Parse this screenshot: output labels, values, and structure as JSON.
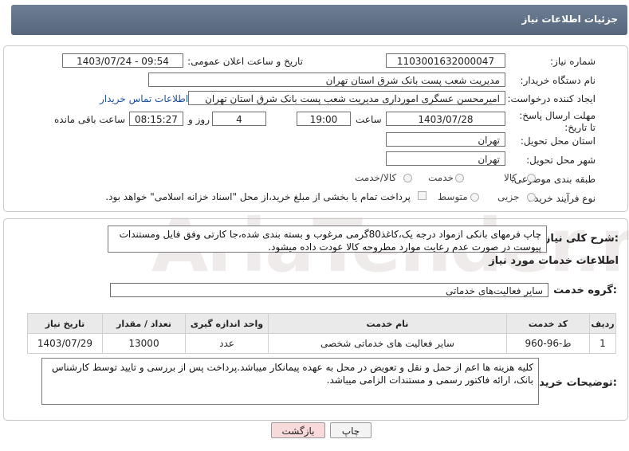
{
  "header": {
    "title": "جزئیات اطلاعات نیاز"
  },
  "fields": {
    "need_number_label": "شماره نیاز:",
    "need_number": "1103001632000047",
    "announce_label": "تاریخ و ساعت اعلان عمومی:",
    "announce_value": "1403/07/24 - 09:54",
    "buyer_label": "نام دستگاه خریدار:",
    "buyer_value": "مدیریت شعب پست بانک شرق استان تهران",
    "requester_label": "ایجاد کننده درخواست:",
    "requester_value": "امیرمحسن عسگری امورداری مدیریت شعب پست بانک شرق استان تهران",
    "contact_link": "اطلاعات تماس خریدار",
    "deadline_label": "مهلت ارسال پاسخ: تا تاریخ:",
    "deadline_date": "1403/07/28",
    "time_label": "ساعت",
    "deadline_time": "19:00",
    "days_value": "4",
    "days_label": "روز و",
    "remaining_time": "08:15:27",
    "remaining_label": "ساعت باقی مانده",
    "province_label": "استان محل تحویل:",
    "province_value": "تهران",
    "city_label": "شهر محل تحویل:",
    "city_value": "تهران",
    "category_label": "طبقه بندی موضوعی:",
    "category_options": [
      "کالا",
      "خدمت",
      "کالا/خدمت"
    ],
    "process_label": "نوع فرآیند خرید :",
    "process_options": [
      "جزیی",
      "متوسط"
    ],
    "payment_note": "پرداخت تمام یا بخشی از مبلغ خرید،از محل \"اسناد خزانه اسلامی\" خواهد بود."
  },
  "summary": {
    "label": "شرح کلی نیاز:",
    "text": "چاپ فرمهای بانکی ازمواد درجه یک،کاغذ80گرمی مرغوب و بسته بندی شده،جا کارتی وفق فایل ومستندات پیوست در صورت عدم رعایت موارد مطروحه کالا عودت داده میشود."
  },
  "services": {
    "section_title": "اطلاعات خدمات مورد نیاز",
    "group_label": "گروه خدمت:",
    "group_value": "سایر فعالیت‌های خدماتی",
    "columns": [
      "ردیف",
      "کد خدمت",
      "نام خدمت",
      "واحد اندازه گیری",
      "تعداد / مقدار",
      "تاریخ نیاز"
    ],
    "rows": [
      [
        "1",
        "ط-96-960",
        "سایر فعالیت های خدماتی شخصی",
        "عدد",
        "13000",
        "1403/07/29"
      ]
    ]
  },
  "buyer_notes": {
    "label": "توضیحات خریدار:",
    "text": "کلیه هزینه ها اعم از حمل و نقل و تعویض در محل به عهده پیمانکار میباشد.پرداخت پس از بررسی و تایید توسط کارشناس بانک، ارائه فاکتور رسمی و مستندات الزامی میباشد."
  },
  "buttons": {
    "print": "چاپ",
    "back": "بازگشت"
  },
  "watermark": "AriaTender.net",
  "colors": {
    "header": "#5f7087",
    "link": "#1a4fa0",
    "back_button": "#f8dada"
  }
}
